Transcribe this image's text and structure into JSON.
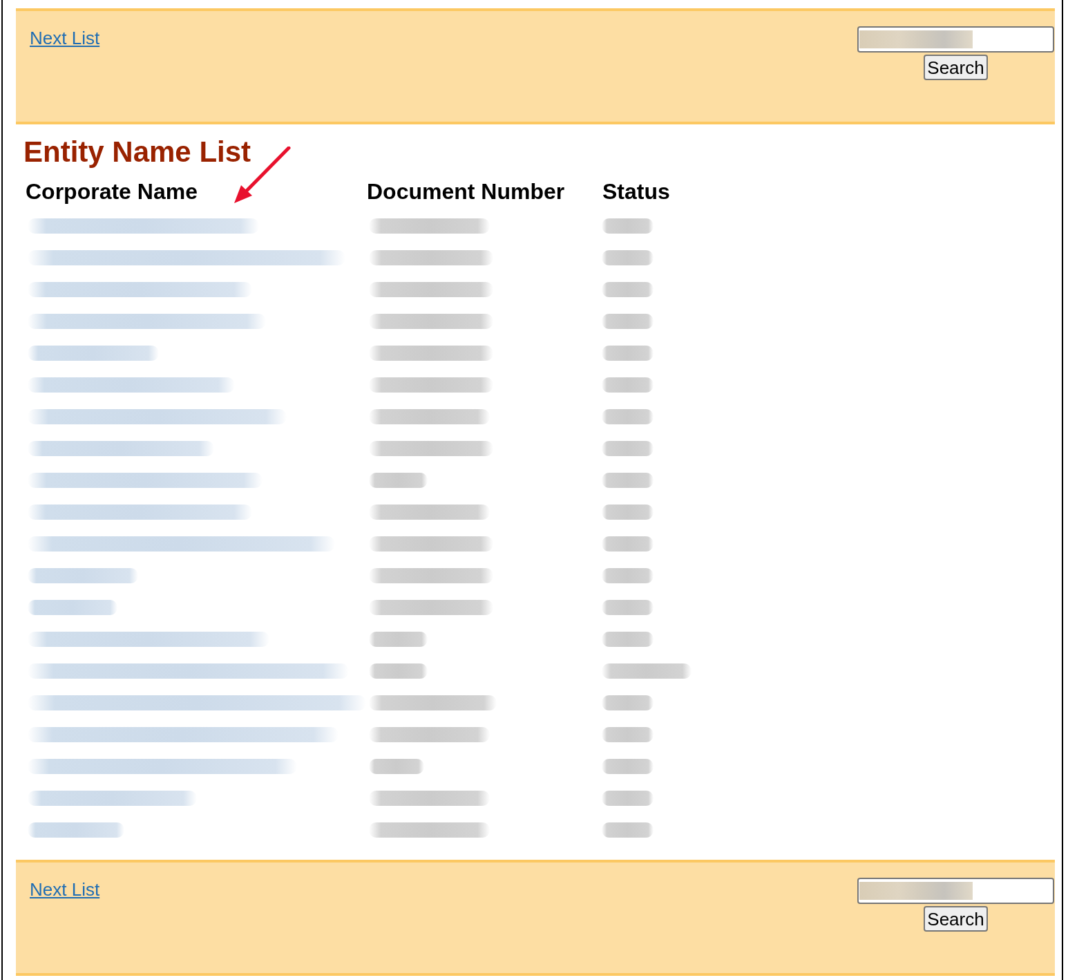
{
  "top_bar": {
    "next_link": "Next List",
    "search_field": {
      "blurred": true
    },
    "search_button": "Search"
  },
  "heading": "Entity Name List",
  "annotations": [
    {
      "kind": "arrow"
    }
  ],
  "table": {
    "columns": [
      "Corporate Name",
      "Document Number",
      "Status"
    ],
    "rows": [
      {
        "kind": "blurred"
      },
      {
        "kind": "blurred"
      },
      {
        "kind": "blurred"
      },
      {
        "kind": "blurred"
      },
      {
        "kind": "blurred"
      },
      {
        "kind": "blurred"
      },
      {
        "kind": "blurred"
      },
      {
        "kind": "blurred"
      },
      {
        "kind": "blurred"
      },
      {
        "kind": "blurred"
      },
      {
        "kind": "blurred"
      },
      {
        "kind": "blurred"
      },
      {
        "kind": "blurred"
      },
      {
        "kind": "blurred"
      },
      {
        "kind": "blurred"
      },
      {
        "kind": "blurred"
      },
      {
        "kind": "blurred"
      },
      {
        "kind": "blurred"
      },
      {
        "kind": "blurred"
      },
      {
        "kind": "blurred"
      }
    ]
  },
  "bottom_bar": {
    "next_link": "Next List",
    "search_field": {
      "blurred": true
    },
    "search_button": "Search"
  }
}
